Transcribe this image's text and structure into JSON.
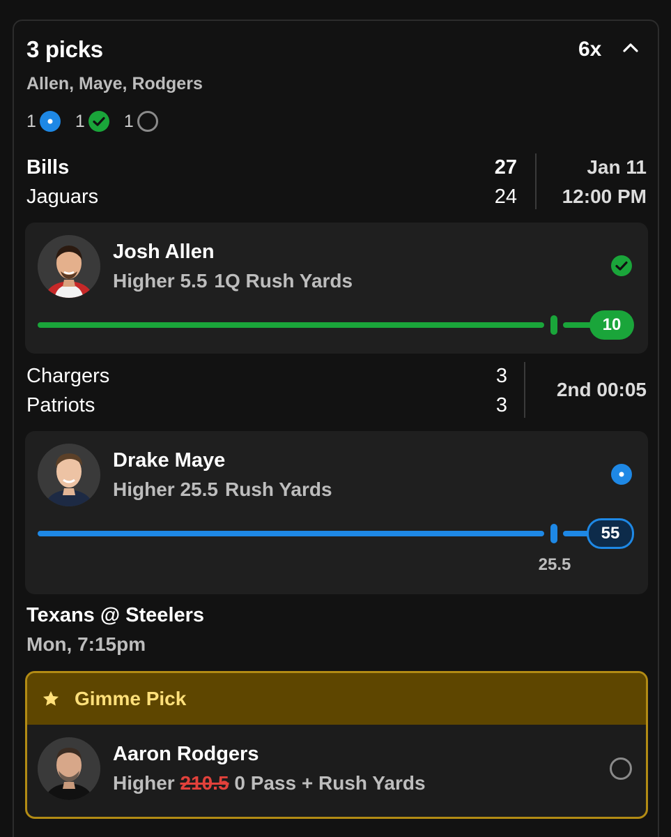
{
  "header": {
    "title": "3 picks",
    "multiplier": "6x",
    "players_summary": "Allen, Maye, Rodgers"
  },
  "status_counts": [
    {
      "count": "1",
      "icon": "live-dot-icon",
      "color": "#1e88e5"
    },
    {
      "count": "1",
      "icon": "check-circle-icon",
      "color": "#1aa53a"
    },
    {
      "count": "1",
      "icon": "empty-circle-icon",
      "color": "#8a8a8a"
    }
  ],
  "games": [
    {
      "team1": "Bills",
      "score1": "27",
      "team2": "Jaguars",
      "score2": "24",
      "date": "Jan 11",
      "time": "12:00 PM"
    },
    {
      "team1": "Chargers",
      "score1": "3",
      "team2": "Patriots",
      "score2": "3",
      "status": "2nd 00:05"
    },
    {
      "matchup": "Texans @ Steelers",
      "time": "Mon, 7:15pm"
    }
  ],
  "picks": [
    {
      "player": "Josh Allen",
      "direction": "Higher",
      "line": "5.5",
      "stat": "1Q Rush Yards",
      "current": "10",
      "progress": 1.0,
      "status_icon": "check-circle-icon",
      "color": "#1aa53a"
    },
    {
      "player": "Drake Maye",
      "direction": "Higher",
      "line": "25.5",
      "stat": "Rush Yards",
      "current": "55",
      "progress": 1.0,
      "line_marker_label": "25.5",
      "status_icon": "live-dot-icon",
      "color": "#1e88e5"
    },
    {
      "badge": "Gimme Pick",
      "player": "Aaron Rodgers",
      "direction": "Higher",
      "original_line": "210.5",
      "line": "0",
      "stat": "Pass + Rush Yards",
      "status_icon": "empty-circle-icon",
      "accent": "#b28b14"
    }
  ]
}
